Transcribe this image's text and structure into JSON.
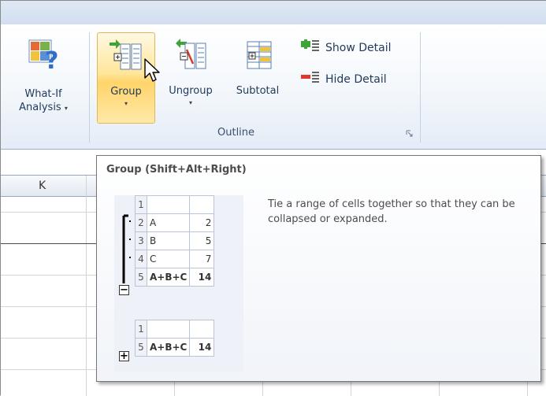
{
  "ribbon": {
    "whatif": {
      "label_line1": "What-If",
      "label_line2": "Analysis",
      "caret": "▾",
      "icon": "what-if-analysis-icon"
    },
    "outline_group": {
      "label": "Outline",
      "group": {
        "label": "Group",
        "caret": "▾",
        "icon": "group-rows-icon"
      },
      "ungroup": {
        "label": "Ungroup",
        "caret": "▾",
        "icon": "ungroup-rows-icon"
      },
      "subtotal": {
        "label": "Subtotal",
        "icon": "subtotal-icon"
      },
      "show_detail": {
        "label": "Show Detail",
        "icon": "show-detail-icon"
      },
      "hide_detail": {
        "label": "Hide Detail",
        "icon": "hide-detail-icon"
      }
    }
  },
  "sheet": {
    "column_k": "K"
  },
  "tooltip": {
    "title": "Group (Shift+Alt+Right)",
    "description": "Tie a range of cells together so that they can be collapsed or expanded.",
    "expanded_rows": [
      {
        "row": "1",
        "label": "",
        "value": ""
      },
      {
        "row": "2",
        "label": "A",
        "value": "2"
      },
      {
        "row": "3",
        "label": "B",
        "value": "5"
      },
      {
        "row": "4",
        "label": "C",
        "value": "7"
      },
      {
        "row": "5",
        "label": "A+B+C",
        "value": "14"
      }
    ],
    "collapsed_rows": [
      {
        "row": "1",
        "label": "",
        "value": ""
      },
      {
        "row": "5",
        "label": "A+B+C",
        "value": "14"
      }
    ],
    "collapse_symbol": "−",
    "expand_symbol": "+"
  },
  "colors": {
    "hover_fill": "#ffe69a",
    "hover_border": "#e4b557",
    "ribbon_text": "#1e395b"
  }
}
